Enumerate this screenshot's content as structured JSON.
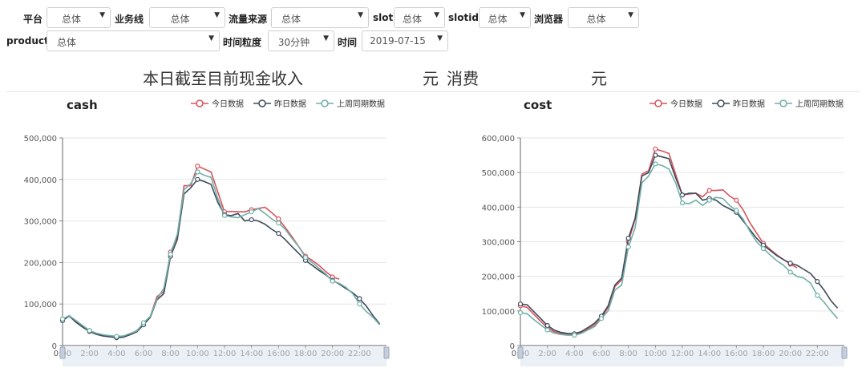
{
  "filters": {
    "platform_label": "平台",
    "platform_value": "总体",
    "business_label": "业务线",
    "business_value": "总体",
    "source_label": "流量来源",
    "source_value": "总体",
    "slot_label": "slot",
    "slot_value": "总体",
    "slotid_label": "slotid",
    "slotid_value": "总体",
    "browser_label": "浏览器",
    "browser_value": "总体",
    "product_label": "product",
    "product_value": "总体",
    "granularity_label": "时间粒度",
    "granularity_value": "30分钟",
    "date_label": "时间",
    "date_value": "2019-07-15"
  },
  "summary": {
    "income_text": "本日截至目前现金收入",
    "income_value": "",
    "income_unit": "元",
    "spend_text": "消费",
    "spend_value": "",
    "spend_unit": "元"
  },
  "colors": {
    "today": "#d9535a",
    "yesterday": "#3f4a5c",
    "last_week": "#6fb0a8",
    "grid": "#e6e6e6",
    "axis_text": "#555555"
  },
  "chart_data": [
    {
      "type": "line",
      "title": "cash",
      "legend_position": "top-right",
      "grid": true,
      "ylim": [
        0,
        500000
      ],
      "y_ticks": [
        "0",
        "100,000",
        "200,000",
        "300,000",
        "400,000",
        "500,000"
      ],
      "x_ticks": [
        "0:00",
        "2:00",
        "4:00",
        "6:00",
        "8:00",
        "10:00",
        "12:00",
        "14:00",
        "16:00",
        "18:00",
        "20:00",
        "22:00"
      ],
      "x": [
        "0:00",
        "0:30",
        "1:00",
        "1:30",
        "2:00",
        "2:30",
        "3:00",
        "3:30",
        "4:00",
        "4:30",
        "5:00",
        "5:30",
        "6:00",
        "6:30",
        "7:00",
        "7:30",
        "8:00",
        "8:30",
        "9:00",
        "9:30",
        "10:00",
        "10:30",
        "11:00",
        "11:30",
        "12:00",
        "12:30",
        "13:00",
        "13:30",
        "14:00",
        "14:30",
        "15:00",
        "15:30",
        "16:00",
        "16:30",
        "17:00",
        "17:30",
        "18:00",
        "18:30",
        "19:00",
        "19:30",
        "20:00",
        "20:30",
        "21:00",
        "21:30",
        "22:00",
        "22:30",
        "23:00",
        "23:30"
      ],
      "series": [
        {
          "name": "今日数据",
          "color_key": "today",
          "values": [
            62000,
            72000,
            58000,
            46000,
            36000,
            29000,
            25000,
            23000,
            21000,
            22000,
            28000,
            36000,
            53000,
            70000,
            118000,
            130000,
            225000,
            262000,
            385000,
            385000,
            432000,
            425000,
            418000,
            370000,
            322000,
            323000,
            322000,
            322000,
            327000,
            330000,
            333000,
            320000,
            305000,
            284000,
            262000,
            238000,
            215000,
            205000,
            193000,
            178000,
            165000,
            160000,
            null,
            null,
            null,
            null,
            null,
            null
          ]
        },
        {
          "name": "昨日数据",
          "color_key": "yesterday",
          "values": [
            60000,
            71000,
            56000,
            44000,
            34000,
            27000,
            23000,
            21000,
            19000,
            20000,
            26000,
            33000,
            50000,
            68000,
            110000,
            125000,
            215000,
            255000,
            365000,
            380000,
            400000,
            395000,
            388000,
            345000,
            315000,
            313000,
            318000,
            300000,
            303000,
            300000,
            292000,
            280000,
            270000,
            255000,
            238000,
            222000,
            205000,
            193000,
            181000,
            170000,
            157000,
            148000,
            137000,
            127000,
            113000,
            95000,
            72000,
            52000
          ]
        },
        {
          "name": "上周同期数据",
          "color_key": "last_week",
          "values": [
            64000,
            72000,
            60000,
            48000,
            36000,
            30000,
            26000,
            24000,
            22000,
            23000,
            29000,
            35000,
            55000,
            70000,
            112000,
            138000,
            220000,
            268000,
            375000,
            390000,
            418000,
            410000,
            405000,
            355000,
            313000,
            310000,
            308000,
            315000,
            322000,
            330000,
            318000,
            305000,
            295000,
            280000,
            258000,
            238000,
            212000,
            200000,
            186000,
            172000,
            155000,
            150000,
            140000,
            125000,
            100000,
            82000,
            68000,
            50000
          ]
        }
      ]
    },
    {
      "type": "line",
      "title": "cost",
      "legend_position": "top-right",
      "grid": true,
      "ylim": [
        0,
        600000
      ],
      "y_ticks": [
        "0",
        "100,000",
        "200,000",
        "300,000",
        "400,000",
        "500,000",
        "600,000"
      ],
      "x_ticks": [
        "0:00",
        "2:00",
        "4:00",
        "6:00",
        "8:00",
        "10:00",
        "12:00",
        "14:00",
        "16:00",
        "18:00",
        "20:00",
        "22:00"
      ],
      "x": [
        "0:00",
        "0:30",
        "1:00",
        "1:30",
        "2:00",
        "2:30",
        "3:00",
        "3:30",
        "4:00",
        "4:30",
        "5:00",
        "5:30",
        "6:00",
        "6:30",
        "7:00",
        "7:30",
        "8:00",
        "8:30",
        "9:00",
        "9:30",
        "10:00",
        "10:30",
        "11:00",
        "11:30",
        "12:00",
        "12:30",
        "13:00",
        "13:30",
        "14:00",
        "14:30",
        "15:00",
        "15:30",
        "16:00",
        "16:30",
        "17:00",
        "17:30",
        "18:00",
        "18:30",
        "19:00",
        "19:30",
        "20:00",
        "20:30",
        "21:00",
        "21:30",
        "22:00",
        "22:30",
        "23:00",
        "23:30"
      ],
      "series": [
        {
          "name": "今日数据",
          "color_key": "today",
          "values": [
            115000,
            110000,
            90000,
            70000,
            52000,
            40000,
            35000,
            32000,
            32000,
            38000,
            48000,
            60000,
            80000,
            110000,
            170000,
            190000,
            300000,
            365000,
            495000,
            505000,
            568000,
            562000,
            555000,
            495000,
            435000,
            438000,
            440000,
            430000,
            448000,
            448000,
            450000,
            432000,
            420000,
            392000,
            355000,
            325000,
            295000,
            278000,
            262000,
            248000,
            235000,
            225000,
            null,
            null,
            null,
            null,
            null,
            null
          ]
        },
        {
          "name": "昨日数据",
          "color_key": "yesterday",
          "values": [
            120000,
            118000,
            98000,
            78000,
            58000,
            45000,
            38000,
            35000,
            34000,
            40000,
            52000,
            65000,
            85000,
            115000,
            175000,
            195000,
            310000,
            368000,
            490000,
            500000,
            550000,
            545000,
            540000,
            485000,
            435000,
            440000,
            440000,
            420000,
            425000,
            420000,
            405000,
            395000,
            385000,
            360000,
            335000,
            310000,
            290000,
            275000,
            260000,
            248000,
            238000,
            232000,
            220000,
            208000,
            185000,
            160000,
            130000,
            108000
          ]
        },
        {
          "name": "上周同期数据",
          "color_key": "last_week",
          "values": [
            95000,
            92000,
            75000,
            60000,
            45000,
            36000,
            32000,
            30000,
            30000,
            35000,
            45000,
            55000,
            78000,
            100000,
            160000,
            175000,
            285000,
            340000,
            470000,
            490000,
            525000,
            520000,
            510000,
            470000,
            412000,
            410000,
            420000,
            405000,
            420000,
            428000,
            425000,
            405000,
            390000,
            365000,
            330000,
            300000,
            280000,
            262000,
            245000,
            232000,
            212000,
            200000,
            195000,
            180000,
            145000,
            125000,
            100000,
            78000
          ]
        }
      ]
    }
  ]
}
